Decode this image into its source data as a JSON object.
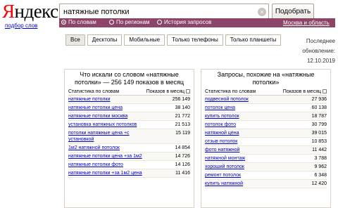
{
  "header": {
    "logo_first": "Я",
    "logo_rest": "ндекс",
    "subnav_link": "подбор слов",
    "search_value": "натяжные потолки",
    "search_button": "Подобрать"
  },
  "radio_options": [
    {
      "label": "По словам",
      "selected": true
    },
    {
      "label": "По регионам",
      "selected": false
    },
    {
      "label": "История запросов",
      "selected": false
    }
  ],
  "region_link": "Москва и область",
  "tabs": [
    "Все",
    "Десктопы",
    "Мобильные",
    "Только телефоны",
    "Только планшеты"
  ],
  "updated": {
    "label1": "Последнее",
    "label2": "обновление:",
    "date": "12.10.2019"
  },
  "left_panel": {
    "title": "Что искали со словом «натяжные потолки» — 256 149 показов в месяц",
    "col_keyword": "Статистика по словам",
    "col_count": "Показов в месяц",
    "rows": [
      {
        "kw": "натяжные потолки",
        "count": "256 149"
      },
      {
        "kw": "натяжные потолки цена",
        "count": "38 140"
      },
      {
        "kw": "натяжные потолки москва",
        "count": "21 772"
      },
      {
        "kw": "установка натяжных потолков",
        "count": "21 513"
      },
      {
        "kw": "потолки натяжные цена +с установкой",
        "count": "15 119"
      },
      {
        "kw": "1м2 натяжной потолок",
        "count": "14 854"
      },
      {
        "kw": "натяжные потолки цена +за 1м2",
        "count": "14 726"
      },
      {
        "kw": "натяжные потолки фото",
        "count": "14 126"
      },
      {
        "kw": "натяжные потолки +за 1м2 цена",
        "count": "11 416"
      }
    ]
  },
  "right_panel": {
    "title": "Запросы, похожие на «натяжные потолки»",
    "col_keyword": "Статистика по словам",
    "col_count": "Показов в месяц",
    "rows": [
      {
        "kw": "подвесной потолок",
        "count": "27 936"
      },
      {
        "kw": "потолок цена",
        "count": "60 138"
      },
      {
        "kw": "купить потолок",
        "count": "18 787"
      },
      {
        "kw": "потолок фото",
        "count": "30 799"
      },
      {
        "kw": "натяжной цена",
        "count": "39 015"
      },
      {
        "kw": "отзыв потолок",
        "count": "10 853"
      },
      {
        "kw": "фото натяжной",
        "count": "11 442"
      },
      {
        "kw": "натяжной монтаж",
        "count": "3 788"
      },
      {
        "kw": "хороший потолок",
        "count": "9 962"
      },
      {
        "kw": "ремонт потолок",
        "count": "6 348"
      },
      {
        "kw": "купить натяжной",
        "count": "12 420"
      }
    ]
  }
}
